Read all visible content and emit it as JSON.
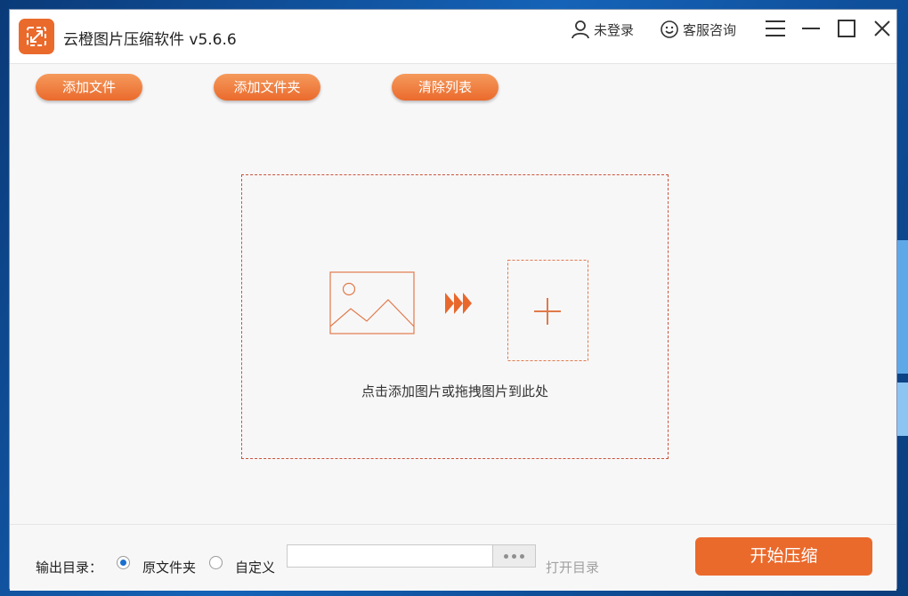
{
  "window": {
    "title": "云橙图片压缩软件 v5.6.6",
    "accent_color": "#ea6a2c"
  },
  "titlebar": {
    "login_label": "未登录",
    "support_label": "客服咨询",
    "icons": [
      "user-icon",
      "smiley-icon",
      "menu-icon",
      "minimize-icon",
      "maximize-icon",
      "close-icon"
    ]
  },
  "toolbar": {
    "add_file_label": "添加文件",
    "add_folder_label": "添加文件夹",
    "clear_list_label": "清除列表"
  },
  "dropzone": {
    "hint": "点击添加图片或拖拽图片到此处",
    "icons": [
      "image-icon",
      "arrows-icon",
      "add-icon"
    ]
  },
  "output": {
    "label": "输出目录：",
    "option_original": "原文件夹",
    "option_custom": "自定义",
    "selected": "原文件夹",
    "path_value": "",
    "open_dir_label": "打开目录",
    "start_label": "开始压缩"
  }
}
